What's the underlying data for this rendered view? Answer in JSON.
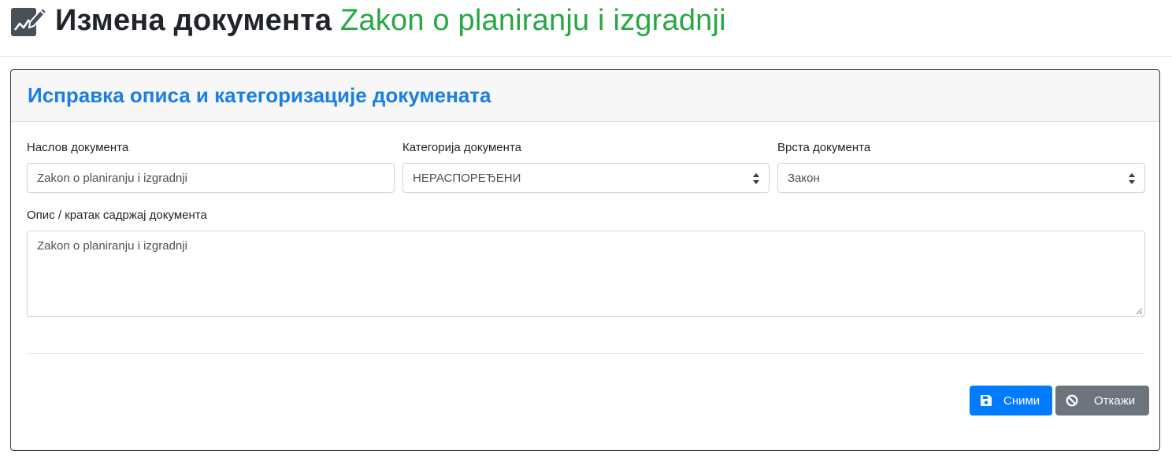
{
  "header": {
    "title_prefix": "Измена документа",
    "document_name": "Zakon o planiranju i izgradnji"
  },
  "card": {
    "title": "Исправка описа и категоризације докумената"
  },
  "form": {
    "title_label": "Наслов документа",
    "title_value": "Zakon o planiranju i izgradnji",
    "category_label": "Категорија документа",
    "category_selected": "НЕРАСПОРЕЂЕНИ",
    "type_label": "Врста документа",
    "type_selected": "Закон",
    "description_label": "Опис / кратак садржај документа",
    "description_value": "Zakon o planiranju i izgradnji"
  },
  "actions": {
    "save_label": "Сними",
    "cancel_label": "Откажи"
  },
  "colors": {
    "accent_green": "#28a745",
    "card_title_blue": "#1a7ee6",
    "primary": "#007bff",
    "secondary": "#6c757d"
  },
  "icons": {
    "header": "edit-document-icon",
    "save": "floppy-disk-icon",
    "cancel": "ban-icon",
    "select": "sort-arrows-icon"
  }
}
